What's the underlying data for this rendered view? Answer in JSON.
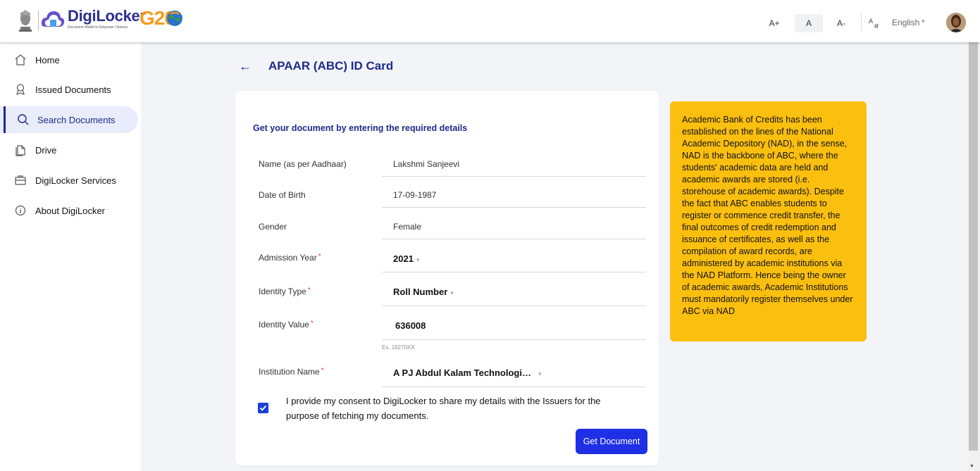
{
  "header": {
    "brand": "DigiLocker",
    "tagline": "Document Wallet to Empower Citizens",
    "g20_text": "G20",
    "font_sizes": [
      "A+",
      "A",
      "A-"
    ],
    "active_font_size": "A",
    "language": "English",
    "icons": [
      "national-emblem-icon",
      "digilocker-cloud-icon",
      "g20-globe-icon",
      "translate-icon",
      "chevron-down-icon",
      "avatar"
    ]
  },
  "sidebar": {
    "items": [
      {
        "label": "Home",
        "icon": "home-icon",
        "active": false
      },
      {
        "label": "Issued Documents",
        "icon": "award-icon",
        "active": false
      },
      {
        "label": "Search Documents",
        "icon": "search-icon",
        "active": true
      },
      {
        "label": "Drive",
        "icon": "files-icon",
        "active": false
      },
      {
        "label": "DigiLocker Services",
        "icon": "briefcase-icon",
        "active": false
      },
      {
        "label": "About DigiLocker",
        "icon": "info-icon",
        "active": false
      }
    ]
  },
  "main": {
    "back_arrow": "←",
    "title": "APAAR (ABC) ID Card",
    "form_heading": "Get your document by entering the required details",
    "fields": {
      "name": {
        "label": "Name (as per Aadhaar)",
        "value": "Lakshmi Sanjeevi"
      },
      "dob": {
        "label": "Date of Birth",
        "value": "17-09-1987"
      },
      "gender": {
        "label": "Gender",
        "value": "Female"
      },
      "admission_year": {
        "label": "Admission Year",
        "value": "2021",
        "required": "*"
      },
      "identity_type": {
        "label": "Identity Type",
        "value": "Roll Number",
        "required": "*"
      },
      "identity_value": {
        "label": "Identity Value",
        "value": "636008",
        "required": "*",
        "hint": "Ex. 16270XX"
      },
      "institution": {
        "label": "Institution Name",
        "value": "A PJ Abdul Kalam Technologi…",
        "required": "*"
      }
    },
    "consent": {
      "checked": true,
      "text": "I provide my consent to DigiLocker to share my details with the Issuers for the purpose of fetching my documents."
    },
    "submit_label": "Get Document"
  },
  "info_panel": {
    "text": "Academic Bank of Credits has been established on the lines of the National Academic Depository (NAD), in the sense, NAD is the backbone of ABC, where the students' academic data are held and academic awards are stored (i.e. storehouse of academic awards). Despite the fact that ABC enables students to register or commence credit transfer, the final outcomes of credit redemption and issuance of certificates, as well as the compilation of award records, are administered by academic institutions via the NAD Platform. Hence being the owner of academic awards, Academic Institutions must mandatorily register themselves under ABC via NAD"
  },
  "colors": {
    "primary": "#1d2a8a",
    "button": "#1f2fe6",
    "info_bg": "#fbbf10",
    "required": "#e53935",
    "g20_orange": "#f39a1e"
  }
}
